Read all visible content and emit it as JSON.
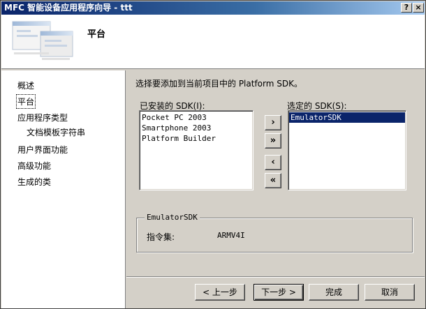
{
  "window": {
    "title": "MFC 智能设备应用程序向导 - ttt",
    "help_label": "?",
    "close_label": "×"
  },
  "header": {
    "title": "平台"
  },
  "nav": {
    "items": [
      {
        "label": "概述"
      },
      {
        "label": "平台"
      },
      {
        "label": "应用程序类型"
      },
      {
        "label": "文档模板字符串"
      },
      {
        "label": "用户界面功能"
      },
      {
        "label": "高级功能"
      },
      {
        "label": "生成的类"
      }
    ]
  },
  "content": {
    "prompt": "选择要添加到当前项目中的 Platform SDK。",
    "installed_label": "已安装的 SDK(I):",
    "installed": [
      "Pocket PC 2003",
      "Smartphone 2003",
      "Platform Builder"
    ],
    "selected_label": "选定的 SDK(S):",
    "selected": [
      "EmulatorSDK"
    ],
    "move_buttons": {
      "add": "›",
      "add_all": "»",
      "remove": "‹",
      "remove_all": "«"
    },
    "group": {
      "title": "EmulatorSDK",
      "instr_label": "指令集:",
      "instr_value": "ARMV4I"
    }
  },
  "buttons": {
    "back": "< 上一步",
    "next": "下一步 >",
    "finish": "完成",
    "cancel": "取消"
  }
}
